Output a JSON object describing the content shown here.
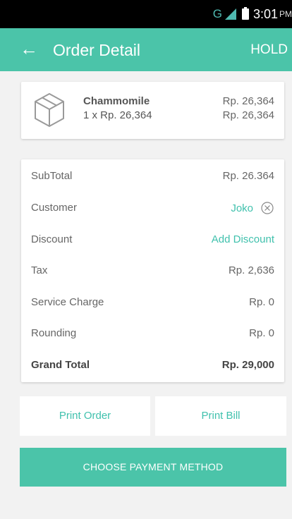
{
  "status_bar": {
    "network": "G",
    "time": "3:01",
    "ampm": "PM"
  },
  "app_bar": {
    "back_glyph": "←",
    "title": "Order Detail",
    "hold_label": "HOLD"
  },
  "item": {
    "name": "Chammomile",
    "qty_line": "1 x Rp. 26,364",
    "unit_price": "Rp. 26,364",
    "total_price": "Rp. 26,364"
  },
  "summary": {
    "rows": [
      {
        "label": "SubTotal",
        "value": "Rp. 26.364"
      },
      {
        "label": "Customer",
        "value": "Joko"
      },
      {
        "label": "Discount",
        "value": "Add Discount"
      },
      {
        "label": "Tax",
        "value": "Rp. 2,636"
      },
      {
        "label": "Service Charge",
        "value": "Rp. 0"
      },
      {
        "label": "Rounding",
        "value": "Rp. 0"
      },
      {
        "label": "Grand Total",
        "value": "Rp. 29,000"
      }
    ]
  },
  "actions": {
    "print_order": "Print Order",
    "print_bill": "Print Bill",
    "choose_payment": "CHOOSE PAYMENT METHOD"
  },
  "colors": {
    "accent": "#4bc4a9",
    "link": "#40c1ad",
    "background": "#f2f2f2"
  },
  "icons": {
    "back": "arrow-left-icon",
    "product": "box-icon",
    "clear_customer": "close-circle-icon"
  }
}
